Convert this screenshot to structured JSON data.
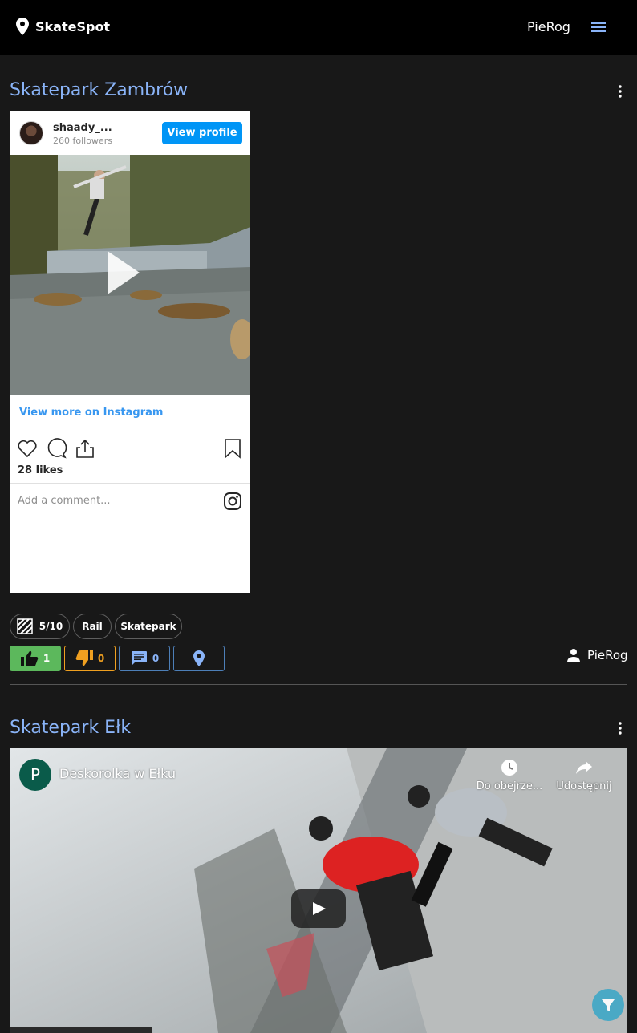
{
  "navbar": {
    "brand": "SkateSpot",
    "user": "PieRog",
    "brand_icon": "location-pin-icon",
    "menu_icon": "hamburger-menu-icon"
  },
  "posts": [
    {
      "title": "Skatepark Zambrów",
      "instagram": {
        "username": "shaady_...",
        "followers": "260 followers",
        "view_profile": "View profile",
        "view_more": "View more on Instagram",
        "likes": "28 likes",
        "comment_placeholder": "Add a comment..."
      },
      "difficulty": "5/10",
      "tags": [
        "Rail",
        "Skatepark"
      ],
      "likes": "1",
      "dislikes": "0",
      "comments": "0",
      "author": "PieRog"
    },
    {
      "title": "Skatepark Ełk",
      "youtube": {
        "channel_initial": "P",
        "video_title": "Deskorolka w Ełku",
        "watch_later": "Do obejrze...",
        "share": "Udostępnij"
      }
    }
  ],
  "colors": {
    "title": "#8ab4f8",
    "like": "#5cb85c",
    "dislike": "#f0a020",
    "instagram_button": "#0095f6"
  }
}
